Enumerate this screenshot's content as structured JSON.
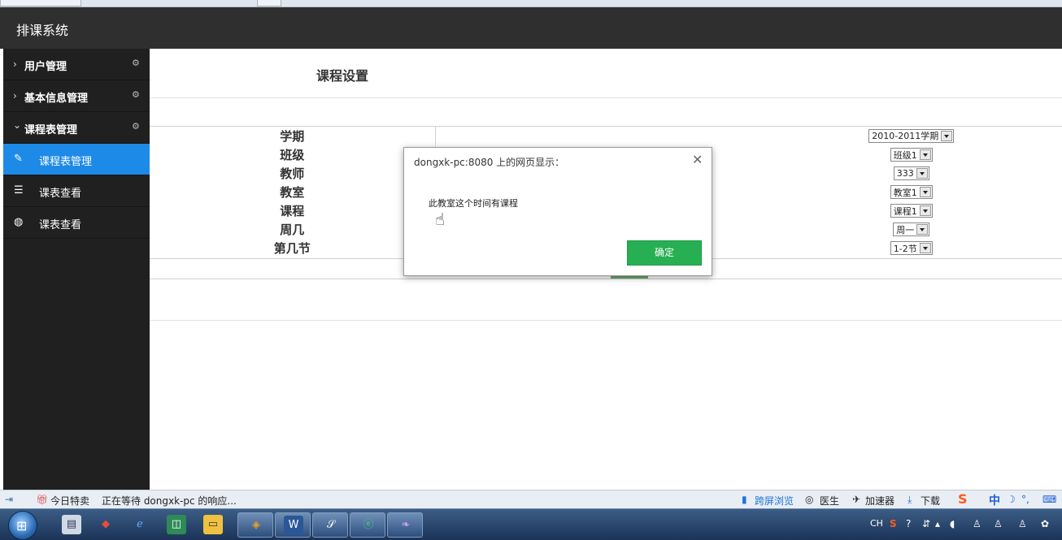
{
  "app": {
    "title": "排课系统"
  },
  "sidebar": {
    "groups": [
      {
        "label": "用户管理",
        "chevron": "›",
        "expanded": false
      },
      {
        "label": "基本信息管理",
        "chevron": "›",
        "expanded": false
      },
      {
        "label": "课程表管理",
        "chevron": "⌄",
        "expanded": true
      }
    ],
    "subitems": [
      {
        "label": "课程表管理",
        "icon": "pencil-icon",
        "active": true
      },
      {
        "label": "课表查看",
        "icon": "list-icon",
        "active": false
      },
      {
        "label": "课表查看",
        "icon": "globe-icon",
        "active": false
      }
    ]
  },
  "main": {
    "title": "课程设置",
    "fields": [
      {
        "label": "学期",
        "value": "2010-2011学期"
      },
      {
        "label": "班级",
        "value": "班级1"
      },
      {
        "label": "教师",
        "value": "333"
      },
      {
        "label": "教室",
        "value": "教室1"
      },
      {
        "label": "课程",
        "value": "课程1"
      },
      {
        "label": "周几",
        "value": "周一"
      },
      {
        "label": "第几节",
        "value": "1-2节"
      }
    ]
  },
  "dialog": {
    "title": "dongxk-pc:8080 上的网页显示：",
    "message": "此教室这个时间有课程",
    "ok_label": "确定",
    "close_glyph": "✕"
  },
  "statusbar": {
    "deal": "今日特卖",
    "loading": "正在等待 dongxk-pc 的响应...",
    "cross_screen": "跨屏浏览",
    "doctor": "医生",
    "accelerator": "加速器",
    "download": "下载",
    "ime_lang": "中"
  },
  "taskbar": {
    "tray_lang": "CH"
  },
  "colors": {
    "header_bg": "#2f2f2f",
    "sidebar_bg": "#202020",
    "active_item": "#1e8ae8",
    "ok_button": "#27b053"
  }
}
